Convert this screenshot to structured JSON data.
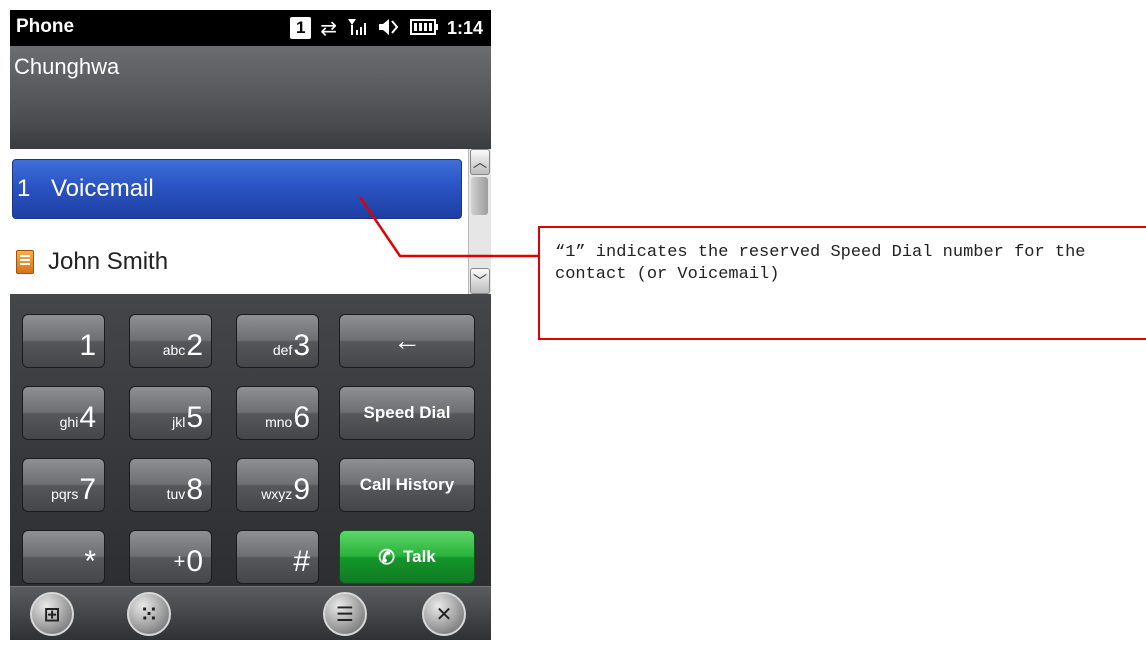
{
  "status_bar": {
    "app_title": "Phone",
    "sim_indicator": "1",
    "icons": [
      "sync-arrows-icon",
      "signal-icon",
      "speaker-icon",
      "battery-icon"
    ],
    "time": "1:14"
  },
  "operator": {
    "name": "Chunghwa"
  },
  "speed_dial_list": {
    "items": [
      {
        "number": "1",
        "label": "Voicemail",
        "selected": true
      },
      {
        "label": "John Smith",
        "icon": "contact-card-icon",
        "selected": false
      }
    ]
  },
  "keypad": {
    "keys": [
      {
        "sub": "",
        "digit": "1"
      },
      {
        "sub": "abc",
        "digit": "2"
      },
      {
        "sub": "def",
        "digit": "3"
      },
      {
        "sub": "ghi",
        "digit": "4"
      },
      {
        "sub": "jkl",
        "digit": "5"
      },
      {
        "sub": "mno",
        "digit": "6"
      },
      {
        "sub": "pqrs",
        "digit": "7"
      },
      {
        "sub": "tuv",
        "digit": "8"
      },
      {
        "sub": "wxyz",
        "digit": "9"
      },
      {
        "sub": "",
        "digit": "*"
      },
      {
        "sub": "+",
        "digit": "0"
      },
      {
        "sub": "",
        "digit": "#"
      }
    ],
    "function_keys": {
      "backspace": "←",
      "speed_dial": "Speed Dial",
      "call_history": "Call History",
      "talk": "Talk"
    }
  },
  "bottom_bar": {
    "buttons": [
      "start-icon",
      "keypad-toggle-icon",
      "menu-icon",
      "close-icon"
    ]
  },
  "callout": {
    "text": "“1” indicates the reserved Speed Dial number for the contact (or Voicemail)"
  },
  "colors": {
    "callout_red": "#e00000",
    "selection_blue": "#2a54c4",
    "talk_green": "#28b33a"
  }
}
